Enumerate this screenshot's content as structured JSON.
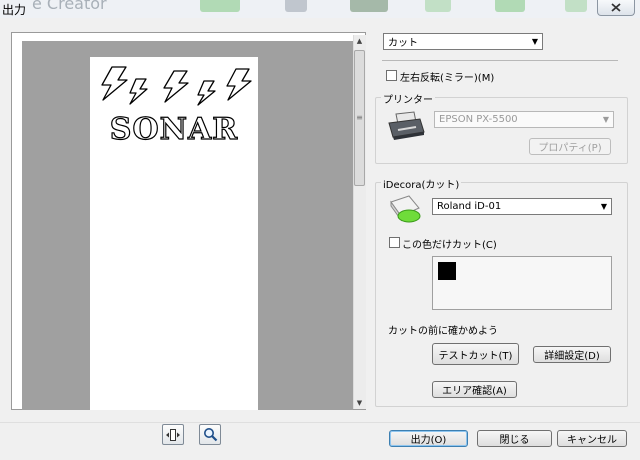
{
  "window": {
    "title": "出力",
    "behind_title": "e Creator",
    "close_icon": "close-icon"
  },
  "preview": {
    "design_text": "SONAR",
    "bolt_icon": "lightning-bolt-icon",
    "fit_icon": "fit-page-icon",
    "zoom_icon": "magnifier-icon"
  },
  "mode": {
    "selected": "カット"
  },
  "mirror": {
    "label": "左右反転(ミラー)(M)",
    "checked": false
  },
  "printer": {
    "group_title": "プリンター",
    "selected": "EPSON PX-5500",
    "properties_label": "プロパティ(P)",
    "icon": "printer-icon"
  },
  "cutter": {
    "group_title": "iDecora(カット)",
    "selected": "Roland iD-01",
    "icon": "cutter-device-icon",
    "this_color_only_label": "この色だけカット(C)",
    "this_color_only_checked": false,
    "swatch_color": "#000000",
    "confirm_before_label": "カットの前に確かめよう",
    "test_cut_label": "テストカット(T)",
    "detail_settings_label": "詳細設定(D)",
    "area_check_label": "エリア確認(A)"
  },
  "footer": {
    "output_label": "出力(O)",
    "close_label": "閉じる",
    "cancel_label": "キャンセル"
  }
}
